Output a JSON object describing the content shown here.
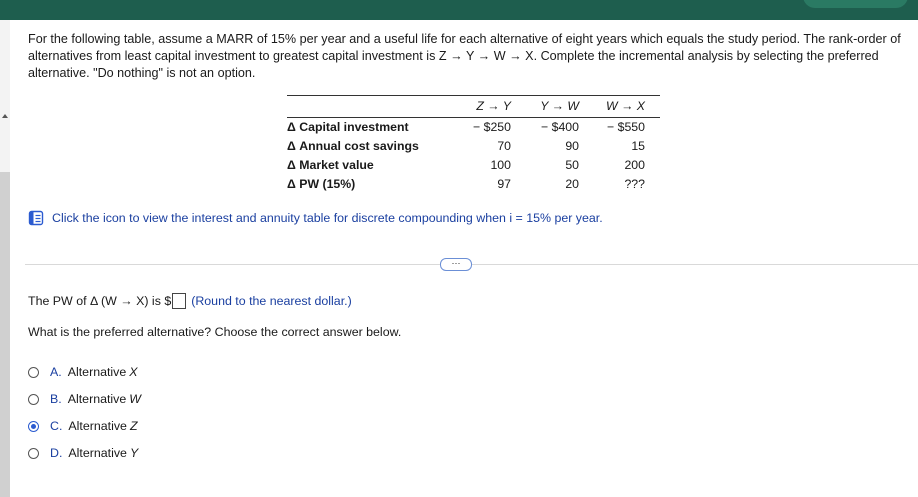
{
  "question": {
    "text": "For the following table, assume a MARR of 15% per year and a useful life for each alternative of eight years which equals the study period. The rank-order of alternatives from least capital investment to greatest capital investment is Z → Y → W → X. Complete the incremental analysis by selecting the preferred alternative. \"Do nothing\" is not an option."
  },
  "table": {
    "columns": [
      "Z → Y",
      "Y → W",
      "W → X"
    ],
    "rows": [
      {
        "label": "Δ Capital investment",
        "values": [
          "− $250",
          "− $400",
          "− $550"
        ]
      },
      {
        "label": "Δ Annual cost savings",
        "values": [
          "70",
          "90",
          "15"
        ]
      },
      {
        "label": "Δ Market value",
        "values": [
          "100",
          "50",
          "200"
        ]
      },
      {
        "label": "Δ PW (15%)",
        "values": [
          "97",
          "20",
          "???"
        ]
      }
    ]
  },
  "reference": {
    "text": "Click the icon to view the interest and annuity table for discrete compounding when i = 15% per year."
  },
  "more_button": "⋯",
  "pw_prompt": {
    "before": "The PW of Δ (W → X) is $",
    "after": "(Round to the nearest dollar.)",
    "answer_value": ""
  },
  "preferred_question": "What is the preferred alternative? Choose the correct answer below.",
  "options": [
    {
      "letter": "A.",
      "text": "Alternative",
      "alt": "X",
      "selected": false
    },
    {
      "letter": "B.",
      "text": "Alternative",
      "alt": "W",
      "selected": false
    },
    {
      "letter": "C.",
      "text": "Alternative",
      "alt": "Z",
      "selected": true
    },
    {
      "letter": "D.",
      "text": "Alternative",
      "alt": "Y",
      "selected": false
    }
  ],
  "colors": {
    "topbar": "#1e5e4e",
    "link_blue": "#1a3fa0",
    "radio_selected": "#2b5bd0"
  }
}
